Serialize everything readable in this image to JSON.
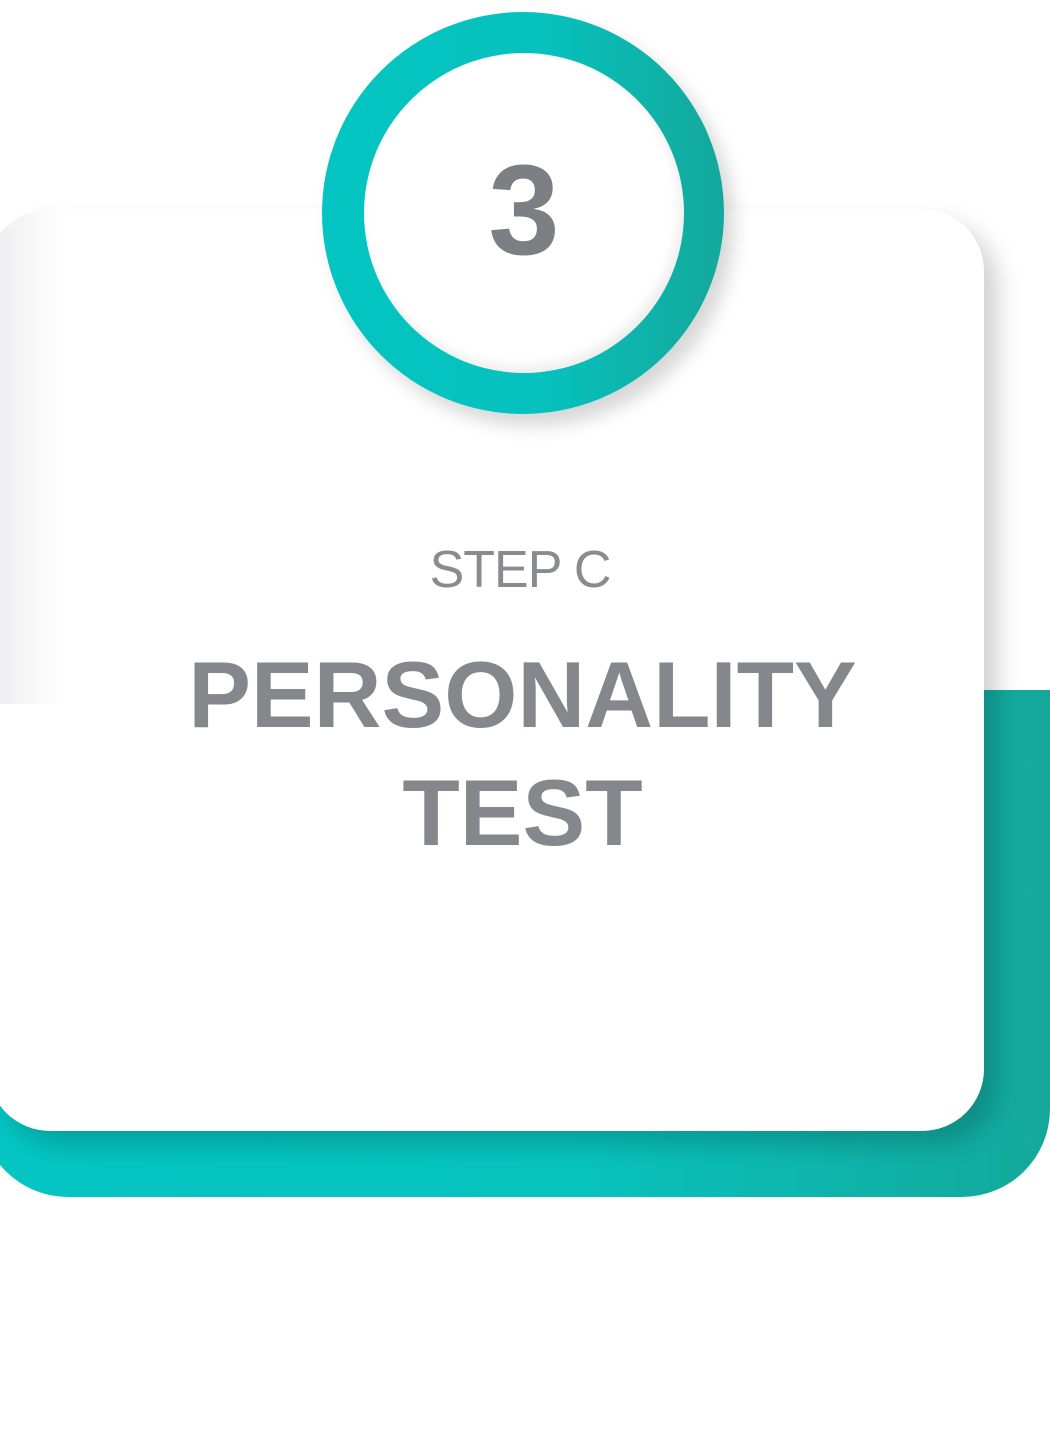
{
  "badge": {
    "number": "3"
  },
  "step": {
    "label": "STEP C",
    "title_line1": "PERSONALITY",
    "title_line2": "TEST"
  },
  "colors": {
    "accent_teal": "#04c5c2",
    "accent_teal_dark": "#14a89b",
    "text_gray": "#86878c",
    "card_white": "#ffffff"
  }
}
